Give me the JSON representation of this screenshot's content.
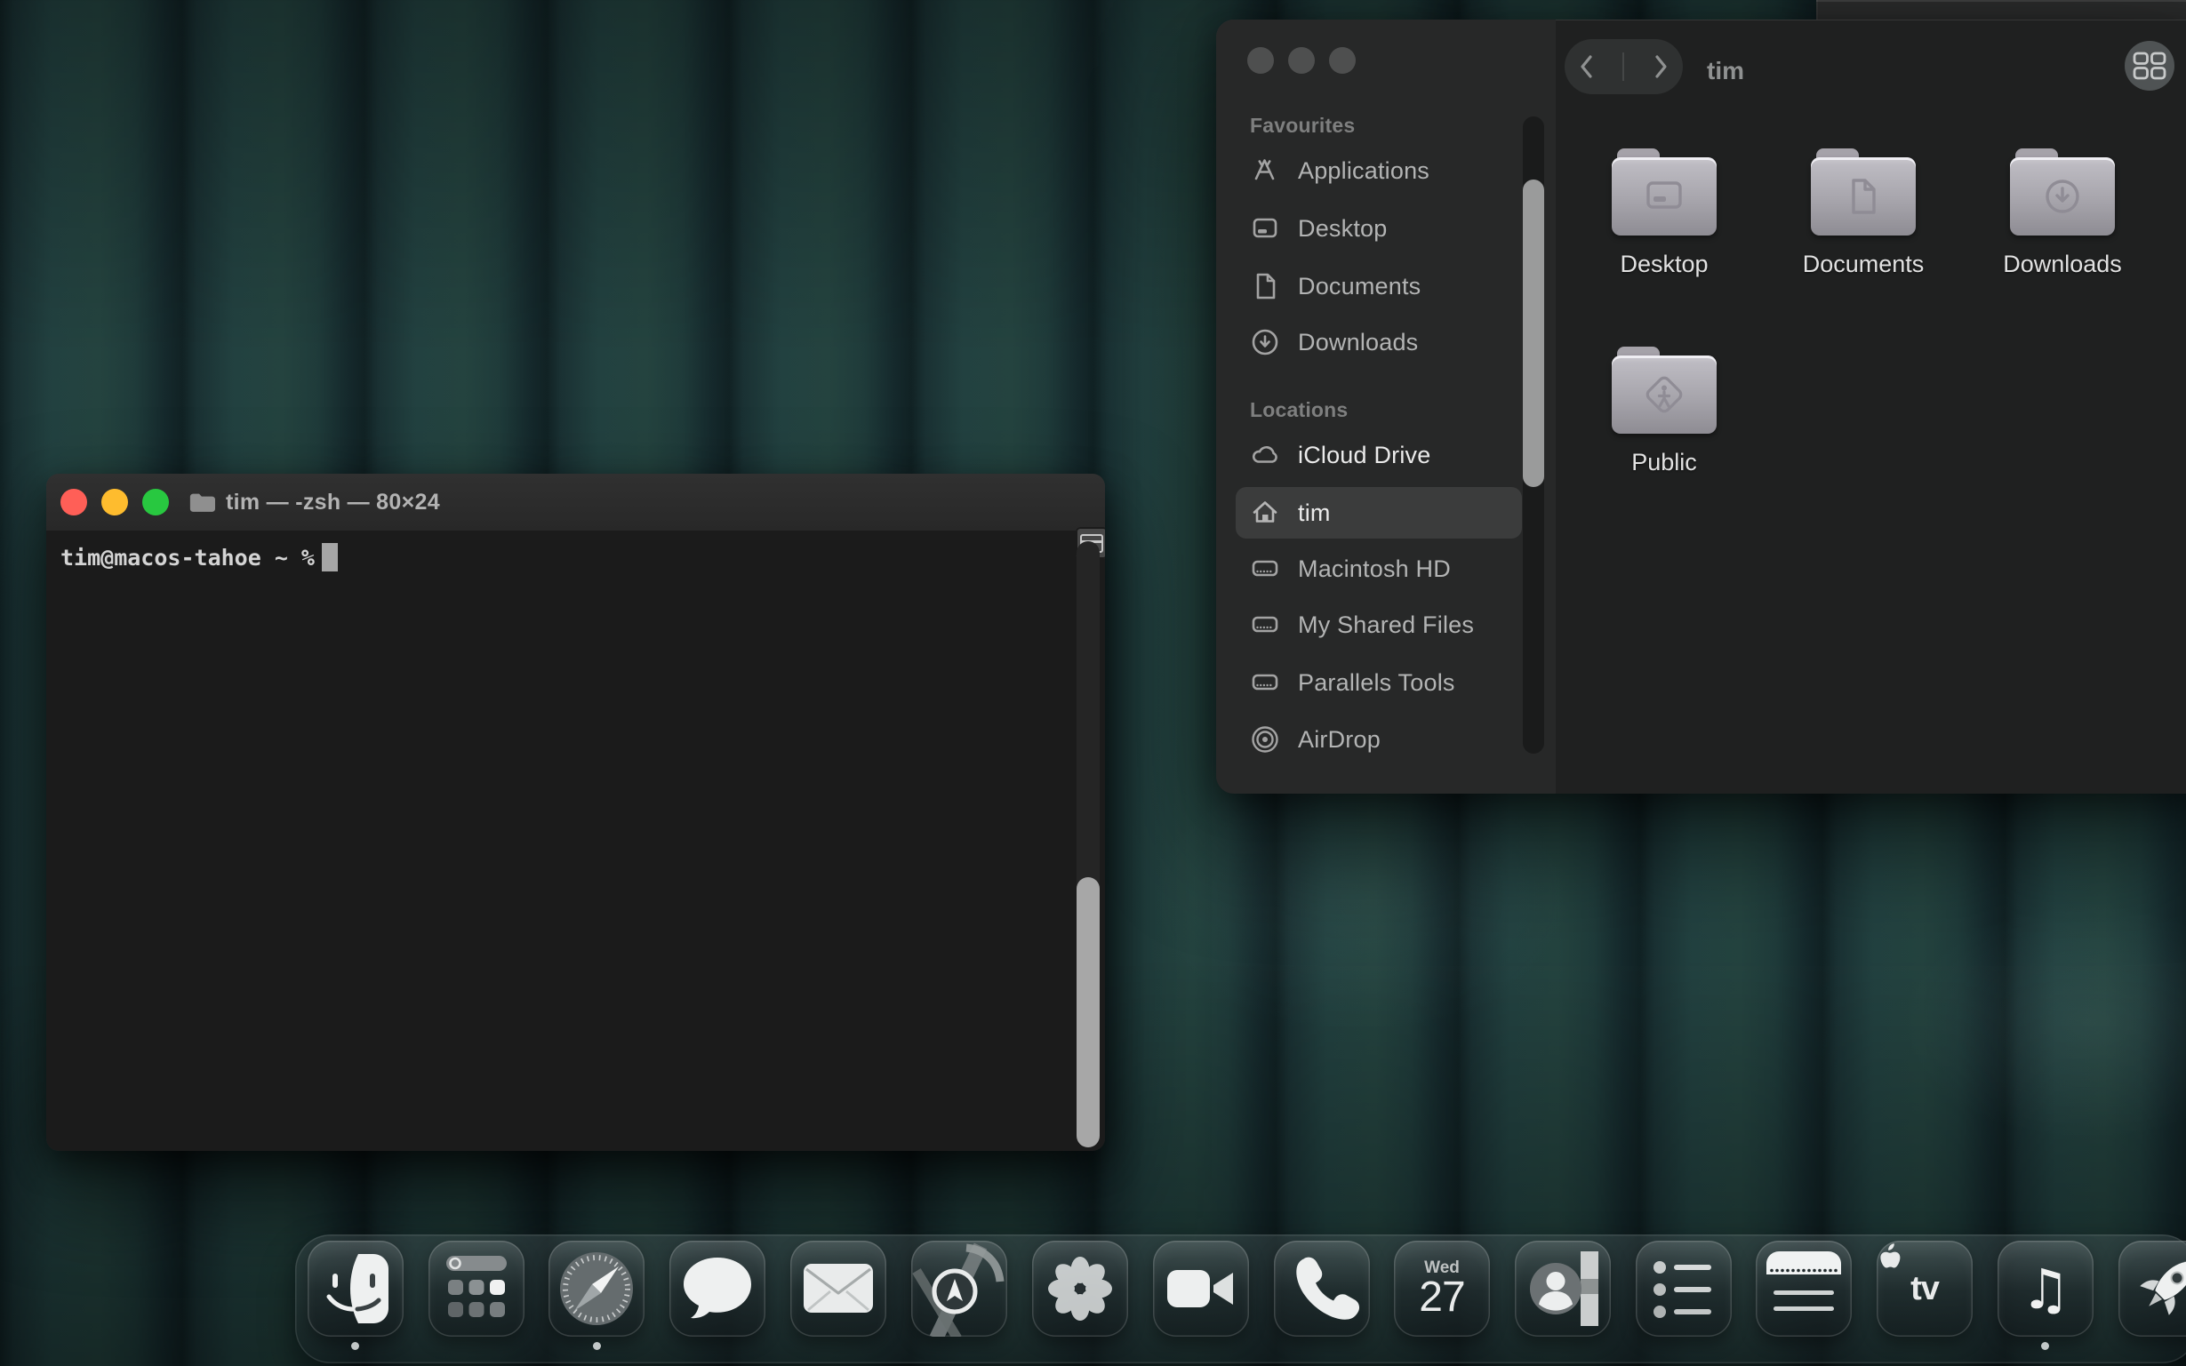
{
  "background_window": {
    "description": "window edge peeking at top right"
  },
  "terminal": {
    "window_title": "tim — -zsh — 80×24",
    "proxy_icon": "folder-icon",
    "prompt": "tim@macos-tahoe ~ %",
    "traffic_lights": {
      "red": "#ff5f57",
      "yellow": "#febc2e",
      "green": "#28c840"
    }
  },
  "finder": {
    "toolbar": {
      "back_icon": "chevron-left-icon",
      "forward_icon": "chevron-right-icon",
      "title": "tim",
      "view_icon": "grid-view-icon"
    },
    "sidebar": {
      "sections": [
        {
          "label": "Favourites",
          "items": [
            {
              "icon": "app-store-icon",
              "label": "Applications"
            },
            {
              "icon": "desktop-icon",
              "label": "Desktop"
            },
            {
              "icon": "document-icon",
              "label": "Documents"
            },
            {
              "icon": "download-circle-icon",
              "label": "Downloads"
            }
          ]
        },
        {
          "label": "Locations",
          "items": [
            {
              "icon": "cloud-icon",
              "label": "iCloud Drive"
            },
            {
              "icon": "home-icon",
              "label": "tim",
              "selected": true
            },
            {
              "icon": "hard-drive-icon",
              "label": "Macintosh HD"
            },
            {
              "icon": "hard-drive-icon",
              "label": "My Shared Files"
            },
            {
              "icon": "hard-drive-icon",
              "label": "Parallels Tools"
            },
            {
              "icon": "airdrop-icon",
              "label": "AirDrop"
            }
          ]
        }
      ]
    },
    "files": [
      {
        "icon": "folder-desktop-icon",
        "label": "Desktop"
      },
      {
        "icon": "folder-documents-icon",
        "label": "Documents"
      },
      {
        "icon": "folder-downloads-icon",
        "label": "Downloads"
      },
      {
        "icon": "folder-public-icon",
        "label": "Public"
      }
    ]
  },
  "dock": {
    "items": [
      {
        "icon": "finder-icon",
        "running": true
      },
      {
        "icon": "launchpad-icon",
        "running": false
      },
      {
        "icon": "safari-icon",
        "running": true
      },
      {
        "icon": "messages-icon",
        "running": false
      },
      {
        "icon": "mail-icon",
        "running": false
      },
      {
        "icon": "maps-icon",
        "running": false
      },
      {
        "icon": "photos-icon",
        "running": false
      },
      {
        "icon": "facetime-icon",
        "running": false
      },
      {
        "icon": "phone-icon",
        "running": false
      },
      {
        "icon": "calendar-icon",
        "running": false
      },
      {
        "icon": "contacts-icon",
        "running": false
      },
      {
        "icon": "reminders-icon",
        "running": false
      },
      {
        "icon": "notes-icon",
        "running": false
      },
      {
        "icon": "apple-tv-icon",
        "running": false
      },
      {
        "icon": "music-icon",
        "running": true
      },
      {
        "icon": "rocket-icon",
        "running": false
      }
    ],
    "calendar": {
      "weekday": "Wed",
      "day": "27"
    },
    "apple_tv_label": "tv"
  }
}
